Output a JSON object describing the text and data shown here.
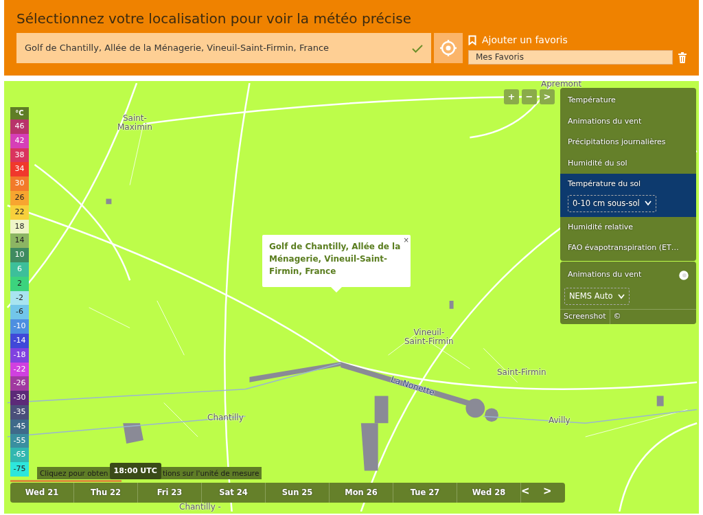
{
  "header": {
    "title": "Sélectionnez votre localisation pour voir la météo précise",
    "location_value": "Golf de Chantilly, Allée de la Ménagerie, Vineuil-Saint-Firmin, France",
    "location_valid": true,
    "favorite_link": "Ajouter un favoris",
    "favorites_value": "Mes Favoris"
  },
  "map": {
    "place_labels": [
      {
        "text": "Saint-\nMaximin",
        "kind": "town"
      },
      {
        "text": "Apremont",
        "kind": "town"
      },
      {
        "text": "Vineuil-\nSaint-Firmin",
        "kind": "town"
      },
      {
        "text": "Saint-Firmin",
        "kind": "town"
      },
      {
        "text": "Chantilly",
        "kind": "town"
      },
      {
        "text": "Avilly",
        "kind": "town"
      },
      {
        "text": "La Nonette",
        "kind": "river"
      },
      {
        "text": "Chantilly -",
        "kind": "town"
      }
    ],
    "popup": {
      "text": "Golf de Chantilly, Allée de la Ménagerie, Vineuil-Saint-Firmin, France",
      "close": "×"
    },
    "zoom_controls": [
      "+",
      "−",
      ">"
    ]
  },
  "legend": {
    "unit": "°C",
    "items": [
      {
        "label": "46",
        "color": "#b8336a"
      },
      {
        "label": "42",
        "color": "#d63fb8"
      },
      {
        "label": "38",
        "color": "#d9345e"
      },
      {
        "label": "34",
        "color": "#f0382c"
      },
      {
        "label": "30",
        "color": "#f27a2a"
      },
      {
        "label": "26",
        "color": "#f7a530"
      },
      {
        "label": "22",
        "color": "#f8d03c"
      },
      {
        "label": "18",
        "color": "#eef5c8"
      },
      {
        "label": "14",
        "color": "#8cb563"
      },
      {
        "label": "10",
        "color": "#3f8a60"
      },
      {
        "label": "6",
        "color": "#3dbf9a"
      },
      {
        "label": "2",
        "color": "#3cd37e"
      },
      {
        "label": "-2",
        "color": "#a8e4f0"
      },
      {
        "label": "-6",
        "color": "#72c6ea"
      },
      {
        "label": "-10",
        "color": "#4d8fe0"
      },
      {
        "label": "-14",
        "color": "#4048d8"
      },
      {
        "label": "-18",
        "color": "#8042e0"
      },
      {
        "label": "-22",
        "color": "#d040e0"
      },
      {
        "label": "-26",
        "color": "#a03aa0"
      },
      {
        "label": "-30",
        "color": "#5c2a78"
      },
      {
        "label": "-35",
        "color": "#4a4f7a"
      },
      {
        "label": "-45",
        "color": "#3f6a8a"
      },
      {
        "label": "-55",
        "color": "#3a8fa0"
      },
      {
        "label": "-65",
        "color": "#32b7b0"
      },
      {
        "label": "-75",
        "color": "#2de6dc"
      }
    ]
  },
  "layers": {
    "items": [
      {
        "label": "Température",
        "selected": false
      },
      {
        "label": "Animations du vent",
        "selected": false
      },
      {
        "label": "Précipitations journalières",
        "selected": false
      },
      {
        "label": "Humidité du sol",
        "selected": false
      },
      {
        "label": "Température du sol",
        "selected": true,
        "option": "0-10 cm sous-sol"
      },
      {
        "label": "Humidité relative",
        "selected": false
      },
      {
        "label": "FAO évapotranspiration (ET…",
        "selected": false
      }
    ]
  },
  "wind_panel": {
    "title": "Animations du vent",
    "on": true,
    "model": "NEMS Auto",
    "footer": [
      "Screenshot",
      "©"
    ]
  },
  "timeline": {
    "hint_parts": [
      "Cliquez pour obten",
      "tions sur l'unité de mesure"
    ],
    "time": "18:00 UTC",
    "level": 0.2,
    "days": [
      {
        "label": "Wed 21"
      },
      {
        "label": "Thu 22"
      },
      {
        "label": "Fri 23"
      },
      {
        "label": "Sat 24"
      },
      {
        "label": "Sun 25"
      },
      {
        "label": "Mon 26"
      },
      {
        "label": "Tue 27"
      },
      {
        "label": "Wed 28"
      }
    ],
    "nav": [
      "<",
      ">"
    ]
  }
}
